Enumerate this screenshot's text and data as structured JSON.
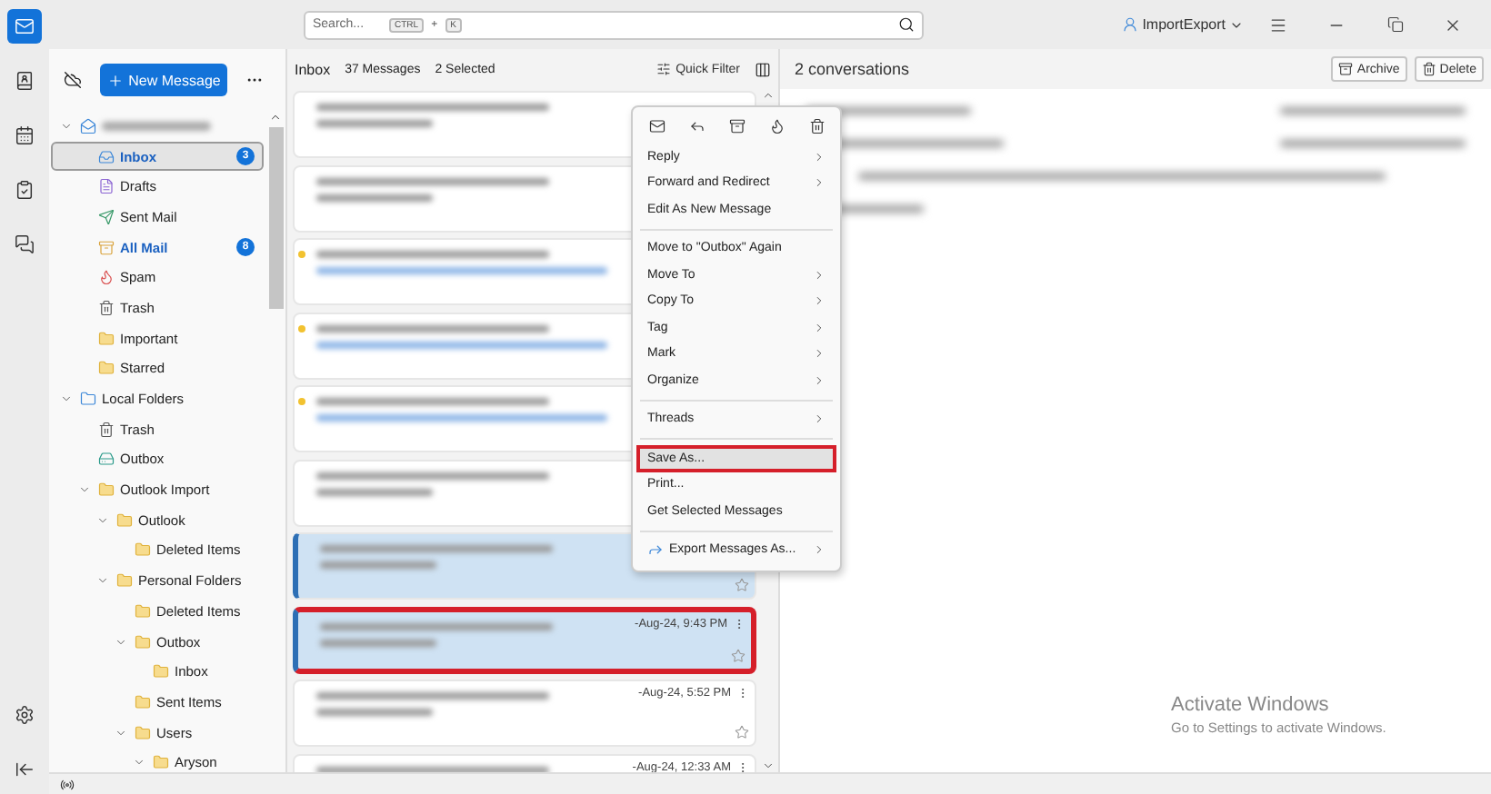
{
  "search": {
    "placeholder": "Search...",
    "keys": [
      "CTRL",
      "+",
      "K"
    ]
  },
  "profile": {
    "label": "ImportExport"
  },
  "new_message": "New Message",
  "folders": [
    {
      "kind": "account",
      "expanded": true,
      "selected": false,
      "unread": false,
      "children": [
        {
          "label": "Inbox",
          "kind": "inbox",
          "selected": true,
          "unread": true,
          "count": "3"
        },
        {
          "label": "Drafts",
          "kind": "drafts",
          "selected": false,
          "unread": false
        },
        {
          "label": "Sent Mail",
          "kind": "sent",
          "selected": false,
          "unread": false
        },
        {
          "label": "All Mail",
          "kind": "archive",
          "selected": false,
          "unread": true,
          "count": "8"
        },
        {
          "label": "Spam",
          "kind": "spam",
          "selected": false,
          "unread": false
        },
        {
          "label": "Trash",
          "kind": "trash",
          "selected": false,
          "unread": false
        },
        {
          "label": "Important",
          "kind": "folder",
          "selected": false,
          "unread": false
        },
        {
          "label": "Starred",
          "kind": "folder",
          "selected": false,
          "unread": false
        }
      ]
    },
    {
      "label": "Local Folders",
      "kind": "local",
      "expanded": true,
      "selected": false,
      "unread": false,
      "children": [
        {
          "label": "Trash",
          "kind": "trash",
          "selected": false,
          "unread": false
        },
        {
          "label": "Outbox",
          "kind": "outbox",
          "selected": false,
          "unread": false
        },
        {
          "label": "Outlook Import",
          "kind": "folder",
          "expanded": true,
          "selected": false,
          "unread": false,
          "children": [
            {
              "label": "Outlook",
              "kind": "folder",
              "expanded": true,
              "selected": false,
              "unread": false,
              "children": [
                {
                  "label": "Deleted Items",
                  "kind": "folder",
                  "selected": false,
                  "unread": false
                }
              ]
            },
            {
              "label": "Personal Folders",
              "kind": "folder",
              "expanded": true,
              "selected": false,
              "unread": false,
              "children": [
                {
                  "label": "Deleted Items",
                  "kind": "folder",
                  "selected": false,
                  "unread": false
                },
                {
                  "label": "Outbox",
                  "kind": "folder",
                  "expanded": true,
                  "selected": false,
                  "unread": false,
                  "children": [
                    {
                      "label": "Inbox",
                      "kind": "folder",
                      "selected": false,
                      "unread": false
                    }
                  ]
                },
                {
                  "label": "Sent Items",
                  "kind": "folder",
                  "selected": false,
                  "unread": false
                },
                {
                  "label": "Users",
                  "kind": "folder",
                  "expanded": true,
                  "selected": false,
                  "unread": false,
                  "children": [
                    {
                      "label": "Aryson",
                      "kind": "folder",
                      "expanded": true,
                      "selected": false,
                      "unread": false
                    }
                  ]
                }
              ]
            }
          ]
        }
      ]
    }
  ],
  "list_header": {
    "folder": "Inbox",
    "count": "37 Messages",
    "selected": "2 Selected",
    "quick_filter": "Quick Filter"
  },
  "messages": [
    {
      "unread": false,
      "selected": false,
      "highlighted": false
    },
    {
      "unread": false,
      "selected": false,
      "highlighted": false
    },
    {
      "unread": true,
      "selected": false,
      "highlighted": false
    },
    {
      "unread": true,
      "selected": false,
      "highlighted": false
    },
    {
      "unread": true,
      "selected": false,
      "highlighted": false
    },
    {
      "unread": false,
      "selected": false,
      "highlighted": false
    },
    {
      "unread": false,
      "selected": true,
      "highlighted": false,
      "star": true
    },
    {
      "unread": false,
      "selected": true,
      "highlighted": true,
      "date": "-Aug-24, 9:43 PM",
      "star": true
    },
    {
      "unread": false,
      "selected": false,
      "highlighted": false,
      "date": "-Aug-24, 5:52 PM",
      "star": true
    },
    {
      "unread": false,
      "selected": false,
      "highlighted": false,
      "date": "-Aug-24, 12:33 AM"
    }
  ],
  "context_menu": [
    {
      "kind": "toolbar"
    },
    {
      "kind": "item",
      "label": "Reply",
      "submenu": true,
      "highlighted": false
    },
    {
      "kind": "item",
      "label": "Forward and Redirect",
      "submenu": true,
      "highlighted": false
    },
    {
      "kind": "item",
      "label": "Edit As New Message",
      "submenu": false,
      "highlighted": false
    },
    {
      "kind": "separator"
    },
    {
      "kind": "item",
      "label": "Move to \"Outbox\" Again",
      "submenu": false,
      "highlighted": false
    },
    {
      "kind": "item",
      "label": "Move To",
      "submenu": true,
      "highlighted": false
    },
    {
      "kind": "item",
      "label": "Copy To",
      "submenu": true,
      "highlighted": false
    },
    {
      "kind": "item",
      "label": "Tag",
      "submenu": true,
      "highlighted": false
    },
    {
      "kind": "item",
      "label": "Mark",
      "submenu": true,
      "highlighted": false
    },
    {
      "kind": "item",
      "label": "Organize",
      "submenu": true,
      "highlighted": false
    },
    {
      "kind": "separator"
    },
    {
      "kind": "item",
      "label": "Threads",
      "submenu": true,
      "highlighted": false
    },
    {
      "kind": "separator"
    },
    {
      "kind": "item",
      "label": "Save As...",
      "submenu": false,
      "highlighted": true
    },
    {
      "kind": "item",
      "label": "Print...",
      "submenu": false,
      "highlighted": false
    },
    {
      "kind": "item",
      "label": "Get Selected Messages",
      "submenu": false,
      "highlighted": false
    },
    {
      "kind": "separator"
    },
    {
      "kind": "icon-item",
      "label": "Export Messages As...",
      "submenu": true,
      "highlighted": false
    }
  ],
  "reader": {
    "title": "2 conversations",
    "buttons": [
      {
        "label": "Archive",
        "kind": "archive"
      },
      {
        "label": "Delete",
        "kind": "delete"
      }
    ]
  },
  "os_notice": {
    "title": "Activate Windows",
    "text": "Go to Settings to activate Windows."
  }
}
